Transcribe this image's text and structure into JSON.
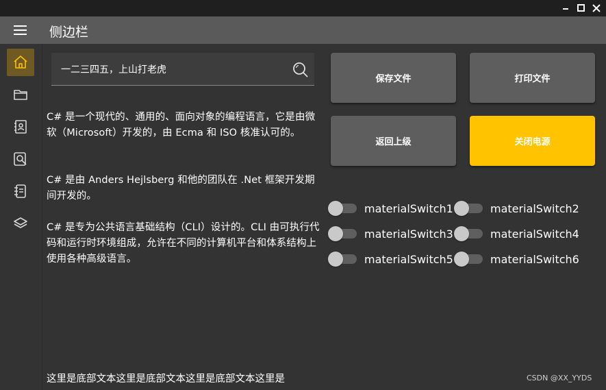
{
  "header": {
    "title": "侧边栏"
  },
  "search": {
    "value": "一二三四五，上山打老虎"
  },
  "content": {
    "paragraphs": [
      "C# 是一个现代的、通用的、面向对象的编程语言，它是由微软（Microsoft）开发的，由 Ecma 和 ISO 核准认可的。",
      "C# 是由 Anders Hejlsberg 和他的团队在 .Net 框架开发期间开发的。",
      "C# 是专为公共语言基础结构（CLI）设计的。CLI 由可执行代码和运行时环境组成，允许在不同的计算机平台和体系结构上使用各种高级语言。"
    ],
    "bottom_text": "这里是底部文本这里是底部文本这里是底部文本这里是"
  },
  "buttons": {
    "save": "保存文件",
    "print": "打印文件",
    "back": "返回上级",
    "power": "关闭电源"
  },
  "switches": [
    {
      "label": "materialSwitch1",
      "on": false
    },
    {
      "label": "materialSwitch2",
      "on": false
    },
    {
      "label": "materialSwitch3",
      "on": false
    },
    {
      "label": "materialSwitch4",
      "on": false
    },
    {
      "label": "materialSwitch5",
      "on": false
    },
    {
      "label": "materialSwitch6",
      "on": false
    }
  ],
  "sidebar": {
    "items": [
      {
        "icon": "home-icon",
        "active": true
      },
      {
        "icon": "folder-icon",
        "active": false
      },
      {
        "icon": "contact-icon",
        "active": false
      },
      {
        "icon": "search-doc-icon",
        "active": false
      },
      {
        "icon": "notebook-icon",
        "active": false
      },
      {
        "icon": "layers-icon",
        "active": false
      }
    ]
  },
  "watermark": "CSDN @XX_YYDS",
  "colors": {
    "accent": "#ffc300",
    "header_bg": "#5a5a5a",
    "body_bg": "#333333",
    "button_gray": "#5e5e5e"
  }
}
